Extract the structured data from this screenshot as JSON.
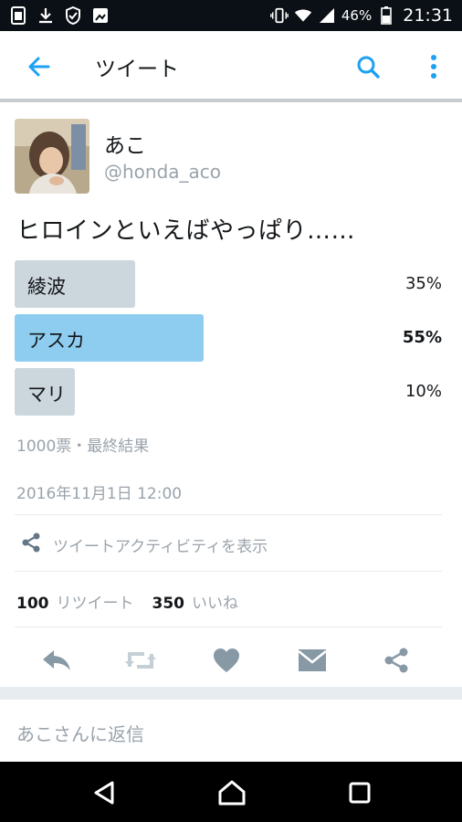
{
  "status_bar": {
    "battery_percent": "46%",
    "time": "21:31",
    "left_icons": [
      "sim-icon",
      "download-icon",
      "shield-icon",
      "image-icon"
    ],
    "right_icons": [
      "vibrate-icon",
      "wifi-icon",
      "signal-icon",
      "battery-icon"
    ]
  },
  "app_bar": {
    "title": "ツイート",
    "back_icon": "arrow-left-icon",
    "search_icon": "search-icon",
    "more_icon": "more-vertical-icon"
  },
  "author": {
    "display_name": "あこ",
    "handle": "@honda_aco"
  },
  "tweet": {
    "text": "ヒロインといえばやっぱり……"
  },
  "poll": {
    "options": [
      {
        "label": "綾波",
        "percent": 35,
        "percent_text": "35%",
        "leading": false
      },
      {
        "label": "アスカ",
        "percent": 55,
        "percent_text": "55%",
        "leading": true
      },
      {
        "label": "マリ",
        "percent": 10,
        "percent_text": "10%",
        "leading": false
      }
    ],
    "meta": "1000票・最終結果",
    "colors": {
      "leading": "#8ecdf0",
      "other": "#ccd6dd"
    }
  },
  "timestamp": "2016年11月1日 12:00",
  "activity_label": "ツイートアクティビティを表示",
  "stats": {
    "retweets": "100",
    "retweets_label": "リツイート",
    "likes": "350",
    "likes_label": "いいね"
  },
  "actions": [
    "reply-icon",
    "retweet-icon",
    "heart-icon",
    "dm-icon",
    "share-icon"
  ],
  "reply": {
    "placeholder": "あこさんに返信"
  },
  "nav_bar": [
    "back-triangle-icon",
    "home-icon",
    "recents-icon"
  ],
  "colors": {
    "accent": "#1da1f2",
    "icon_gray": "#9aa3ab",
    "text": "#14171a"
  }
}
